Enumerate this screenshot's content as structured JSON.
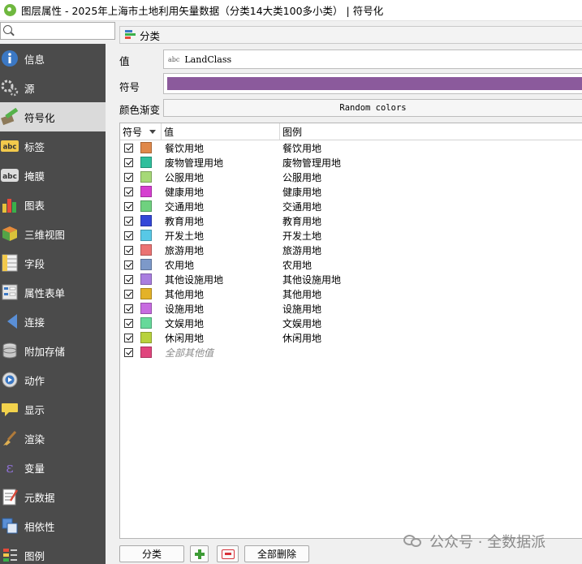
{
  "window": {
    "title": "图层属性 - 2025年上海市土地利用矢量数据（分类14大类100多小类） | 符号化"
  },
  "sidebar": {
    "search_placeholder": "",
    "items": [
      {
        "label": "信息",
        "icon": "info-icon"
      },
      {
        "label": "源",
        "icon": "source-icon"
      },
      {
        "label": "符号化",
        "icon": "symbology-icon",
        "active": true
      },
      {
        "label": "标签",
        "icon": "labels-icon"
      },
      {
        "label": "掩膜",
        "icon": "mask-icon"
      },
      {
        "label": "图表",
        "icon": "diagram-icon"
      },
      {
        "label": "三维视图",
        "icon": "3d-view-icon"
      },
      {
        "label": "字段",
        "icon": "fields-icon"
      },
      {
        "label": "属性表单",
        "icon": "attribute-form-icon"
      },
      {
        "label": "连接",
        "icon": "joins-icon"
      },
      {
        "label": "附加存储",
        "icon": "auxiliary-storage-icon"
      },
      {
        "label": "动作",
        "icon": "actions-icon"
      },
      {
        "label": "显示",
        "icon": "display-icon"
      },
      {
        "label": "渲染",
        "icon": "rendering-icon"
      },
      {
        "label": "变量",
        "icon": "variables-icon"
      },
      {
        "label": "元数据",
        "icon": "metadata-icon"
      },
      {
        "label": "相依性",
        "icon": "dependencies-icon"
      },
      {
        "label": "图例",
        "icon": "legend-icon"
      }
    ]
  },
  "renderer": {
    "type_label": "分类"
  },
  "form": {
    "value_label": "值",
    "value_field": "LandClass",
    "value_tag": "abc",
    "symbol_label": "符号",
    "symbol_color": "#8b5a9c",
    "ramp_label": "颜色渐变",
    "ramp_value": "Random colors"
  },
  "table": {
    "headers": {
      "symbol": "符号",
      "value": "值",
      "legend": "图例"
    },
    "rows": [
      {
        "value": "餐饮用地",
        "legend": "餐饮用地",
        "color": "#e0884a"
      },
      {
        "value": "废物管理用地",
        "legend": "废物管理用地",
        "color": "#2fbf9c"
      },
      {
        "value": "公服用地",
        "legend": "公服用地",
        "color": "#a6d977"
      },
      {
        "value": "健康用地",
        "legend": "健康用地",
        "color": "#d63fd0"
      },
      {
        "value": "交通用地",
        "legend": "交通用地",
        "color": "#6fd17f"
      },
      {
        "value": "教育用地",
        "legend": "教育用地",
        "color": "#3347d8"
      },
      {
        "value": "开发土地",
        "legend": "开发土地",
        "color": "#58c8e6"
      },
      {
        "value": "旅游用地",
        "legend": "旅游用地",
        "color": "#eb7373"
      },
      {
        "value": "农用地",
        "legend": "农用地",
        "color": "#7d99c9"
      },
      {
        "value": "其他设施用地",
        "legend": "其他设施用地",
        "color": "#a97ee0"
      },
      {
        "value": "其他用地",
        "legend": "其他用地",
        "color": "#e3b228"
      },
      {
        "value": "设施用地",
        "legend": "设施用地",
        "color": "#c76be0"
      },
      {
        "value": "文娱用地",
        "legend": "文娱用地",
        "color": "#66d99a"
      },
      {
        "value": "休闲用地",
        "legend": "休闲用地",
        "color": "#b8d23c"
      }
    ],
    "other_row": {
      "value": "全部其他值",
      "legend": "",
      "color": "#e0457d"
    }
  },
  "buttons": {
    "classify": "分类",
    "delete_all": "全部删除"
  },
  "watermark": {
    "text": "公众号 · 全数据派"
  }
}
